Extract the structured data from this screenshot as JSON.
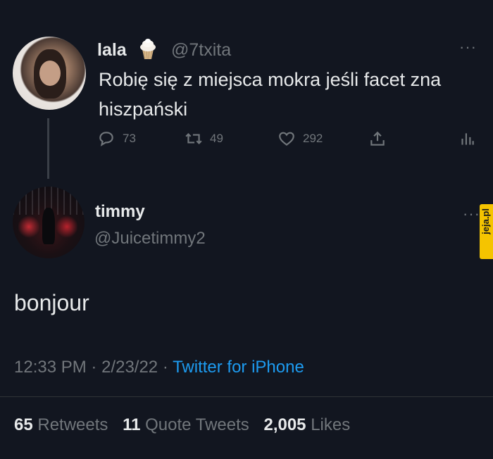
{
  "original_tweet": {
    "display_name": "lala",
    "badge_icon": "cupcake-icon",
    "handle": "@7txita",
    "more_label": "···",
    "text": "Robię się z miejsca mokra jeśli facet zna hiszpański",
    "actions": {
      "replies": "73",
      "retweets": "49",
      "likes": "292"
    }
  },
  "reply_tweet": {
    "display_name": "timmy",
    "handle": "@Juicetimmy2",
    "more_label": "···",
    "text": "bonjour",
    "time": "12:33 PM",
    "date": "2/23/22",
    "separator": "·",
    "source": "Twitter for iPhone",
    "stats": {
      "retweets_count": "65",
      "retweets_label": "Retweets",
      "quotes_count": "11",
      "quotes_label": "Quote Tweets",
      "likes_count": "2,005",
      "likes_label": "Likes"
    }
  },
  "watermark": {
    "text": "jeja.pl"
  },
  "colors": {
    "background": "#121620",
    "text": "#e7e9ea",
    "muted": "#71767b",
    "link": "#1d9bf0",
    "watermark": "#f5c400"
  }
}
